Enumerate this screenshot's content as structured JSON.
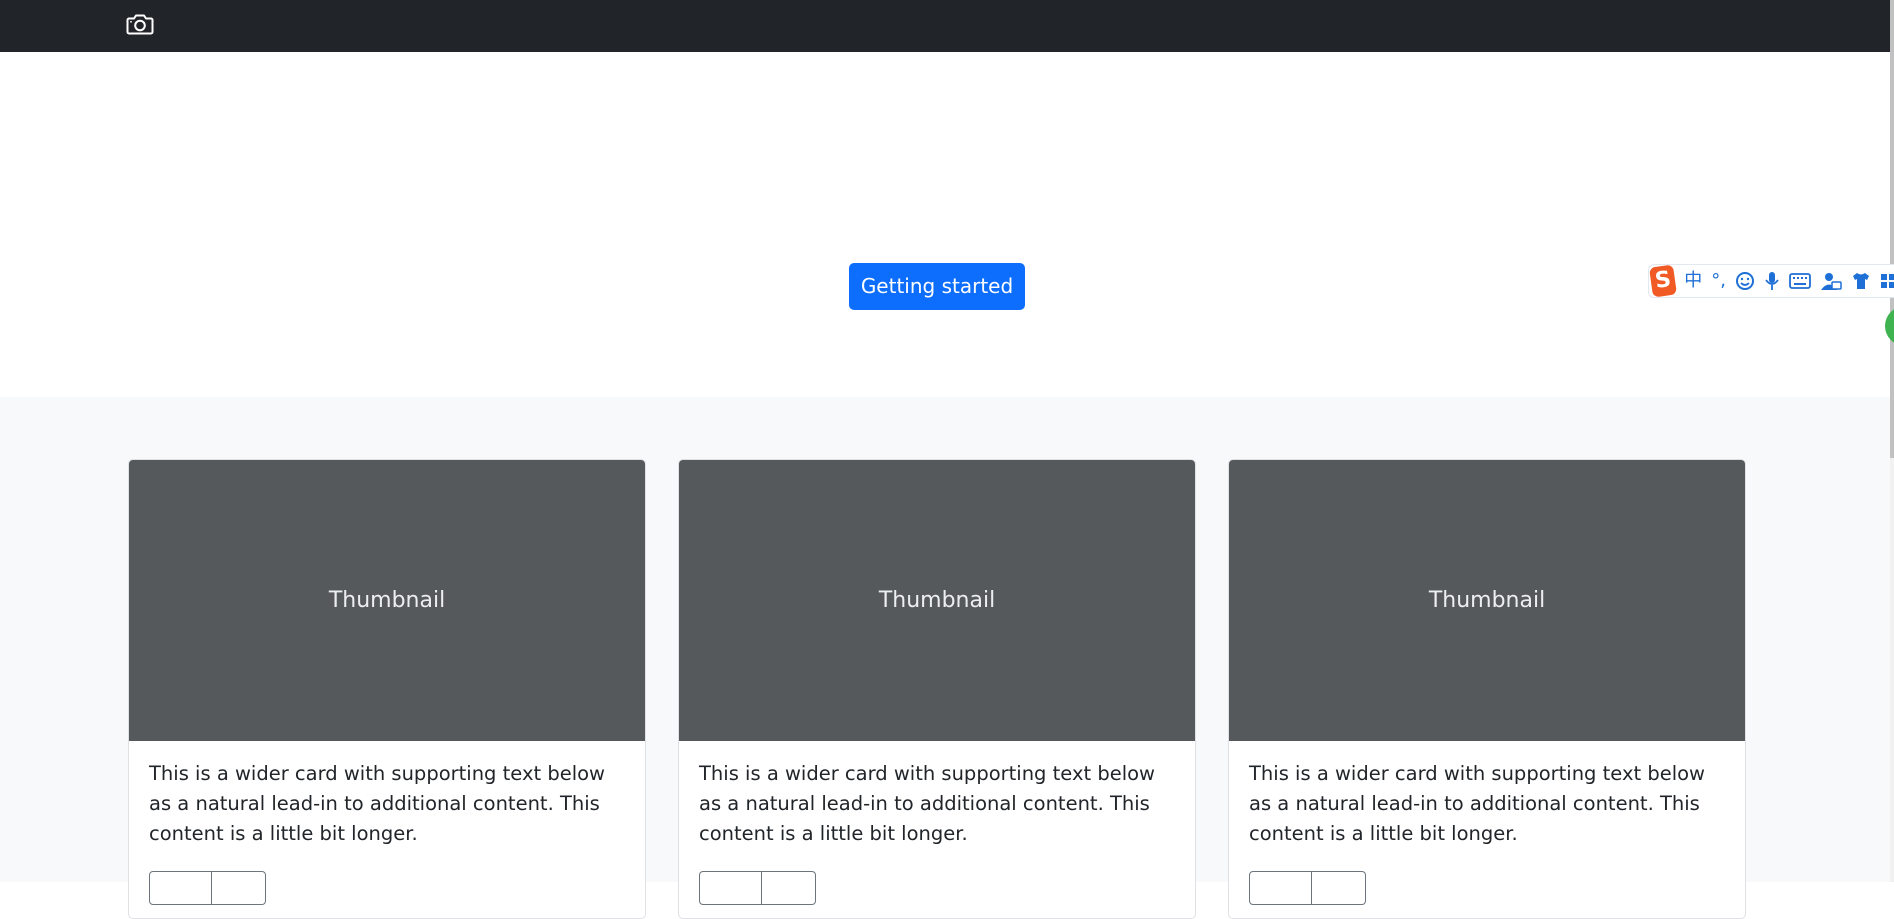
{
  "navbar": {
    "icon": "camera-icon",
    "background": "#212529"
  },
  "hero": {
    "cta_label": "Getting started",
    "accent": "#0d6efd"
  },
  "album": {
    "cards": [
      {
        "thumbnail_label": "Thumbnail",
        "text": "This is a wider card with supporting text below as a natural lead-in to additional content. This content is a little bit longer."
      },
      {
        "thumbnail_label": "Thumbnail",
        "text": "This is a wider card with supporting text below as a natural lead-in to additional content. This content is a little bit longer."
      },
      {
        "thumbnail_label": "Thumbnail",
        "text": "This is a wider card with supporting text below as a natural lead-in to additional content. This content is a little bit longer."
      }
    ]
  },
  "ime_toolbar": {
    "logo_text": "S",
    "mode_label": "中",
    "punct_label": "°,",
    "icons": [
      "smiley-icon",
      "microphone-icon",
      "keyboard-icon",
      "user-icon",
      "shirt-icon",
      "grid-icon"
    ],
    "accent": "#1e6fd6",
    "logo_color": "#f15a24"
  }
}
